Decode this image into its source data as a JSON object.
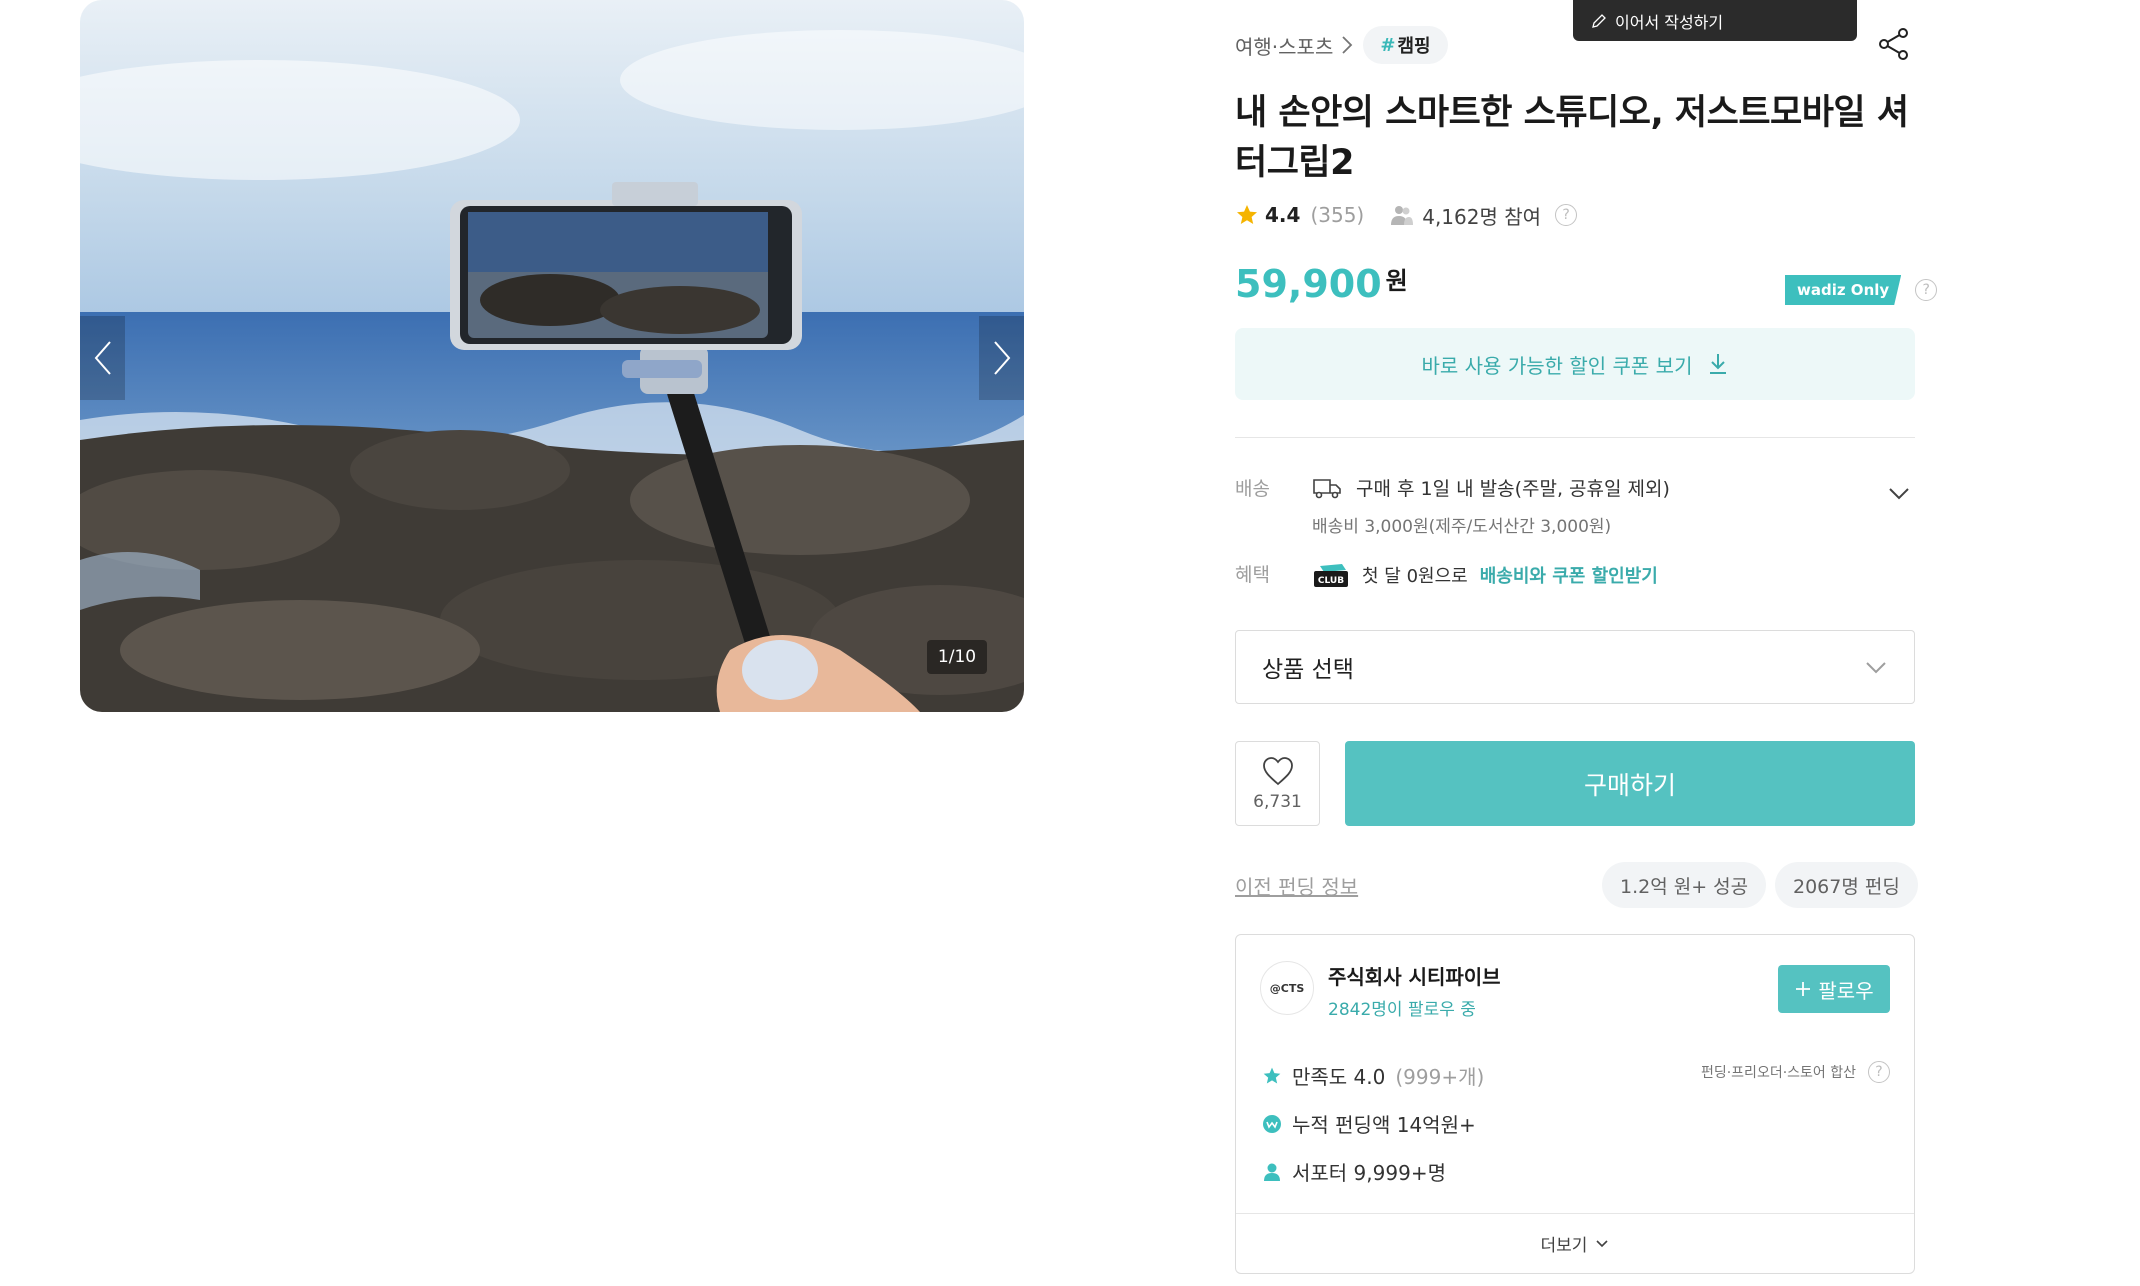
{
  "gallery": {
    "counter": "1/10"
  },
  "resume_write": "이어서 작성하기",
  "breadcrumb": {
    "category": "여행·스포츠",
    "tag": "캠핑"
  },
  "product": {
    "title": "내 손안의 스마트한 스튜디오, 저스트모바일 셔터그립2",
    "rating": "4.4",
    "review_count": "(355)",
    "participants": "4,162명 참여",
    "price": "59,900",
    "currency": "원",
    "wadiz_only": "wadiz Only"
  },
  "coupon_button": "바로 사용 가능한 할인 쿠폰 보기",
  "shipping": {
    "label": "배송",
    "main": "구매 후 1일 내 발송(주말, 공휴일 제외)",
    "fee": "배송비 3,000원(제주/도서산간 3,000원)"
  },
  "benefit": {
    "label": "혜택",
    "club": "CLUB",
    "text": "첫 달 0원으로",
    "highlight": "배송비와 쿠폰 할인받기"
  },
  "option_select": "상품 선택",
  "like_count": "6,731",
  "buy_button": "구매하기",
  "funding_history": {
    "link": "이전 펀딩 정보",
    "chip_amount": "1.2억 원+ 성공",
    "chip_people": "2067명 펀딩"
  },
  "maker": {
    "logo_text": "@CTS",
    "name": "주식회사 시티파이브",
    "followers": "2842명이 팔로우 중",
    "follow_button": "팔로우",
    "satisfaction": "만족도 4.0",
    "satisfaction_count": "(999+개)",
    "satisfaction_note": "펀딩·프리오더·스토어 합산",
    "total_funding": "누적 펀딩액 14억원+",
    "supporters": "서포터 9,999+명",
    "more": "더보기"
  },
  "colors": {
    "accent": "#3dbfbe",
    "button": "#55c2c1",
    "coupon_bg": "#edf8f8",
    "star": "#f5b400"
  }
}
